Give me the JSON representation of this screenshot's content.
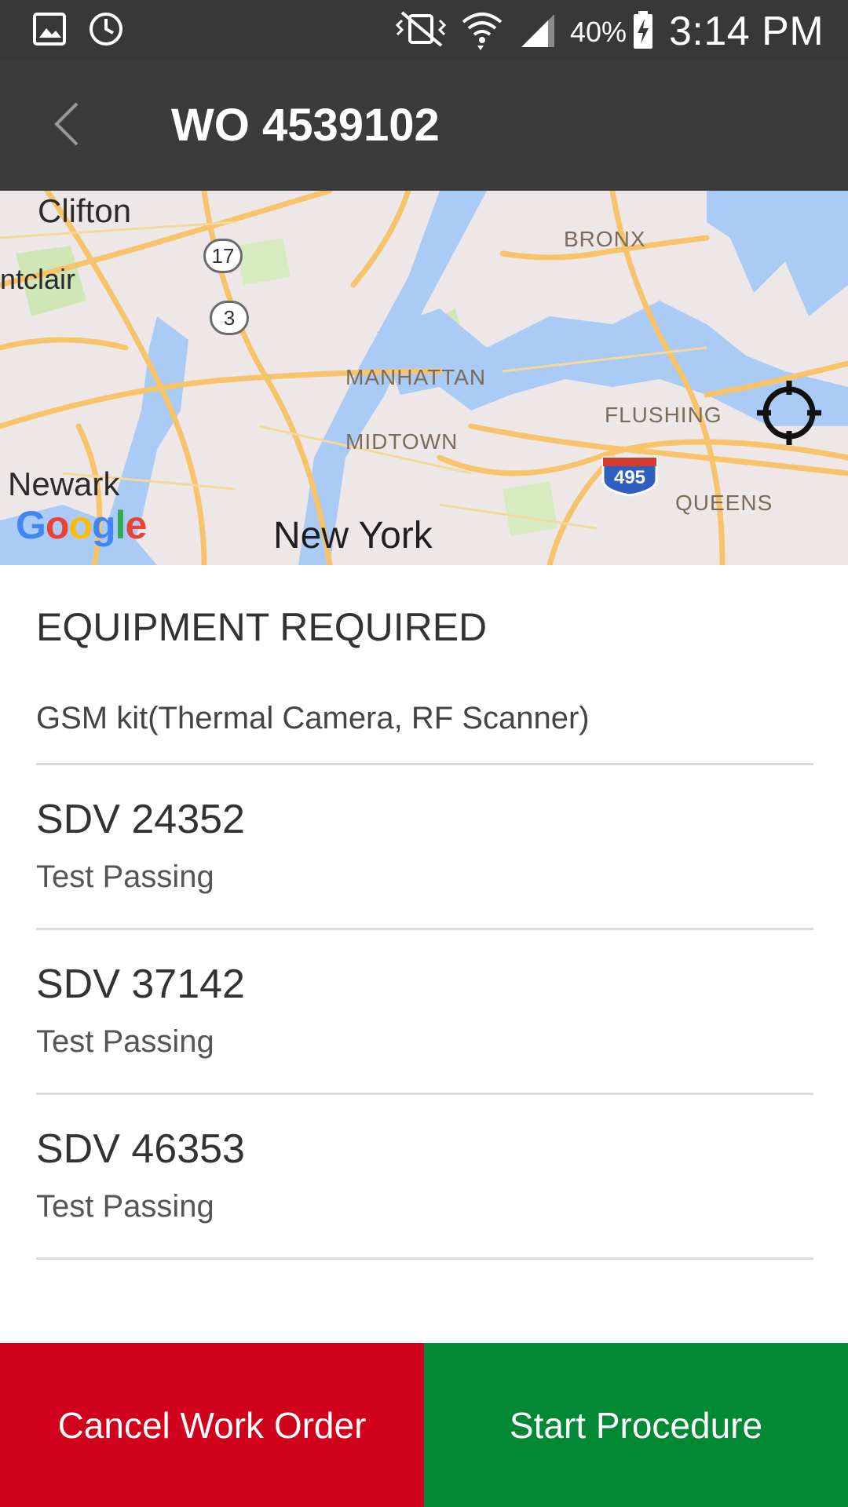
{
  "status_bar": {
    "battery_percent": "40%",
    "time": "3:14 PM",
    "icons": [
      "gallery-icon",
      "sync-icon",
      "vibrate-icon",
      "wifi-icon",
      "signal-icon",
      "battery-charging-icon"
    ]
  },
  "app_bar": {
    "title": "WO 4539102",
    "back_icon": "chevron-left-icon"
  },
  "map": {
    "labels": {
      "clifton": "Clifton",
      "montclair": "ntclair",
      "bronx": "BRONX",
      "manhattan": "MANHATTAN",
      "midtown": "MIDTOWN",
      "flushing": "FLUSHING",
      "queens": "QUEENS",
      "newark": "Newark",
      "new_york": "New York"
    },
    "route_shields": {
      "r17": "17",
      "r3": "3",
      "i495": "495"
    },
    "logo": {
      "g1": "G",
      "o1": "o",
      "o2": "o",
      "g2": "g",
      "l": "l",
      "e": "e"
    },
    "locate_icon": "crosshair-icon"
  },
  "equipment": {
    "heading": "EQUIPMENT REQUIRED",
    "description": "GSM kit(Thermal Camera, RF Scanner)"
  },
  "devices": [
    {
      "name": "SDV 24352",
      "status": "Test Passing"
    },
    {
      "name": "SDV 37142",
      "status": "Test Passing"
    },
    {
      "name": "SDV 46353",
      "status": "Test Passing"
    }
  ],
  "actions": {
    "cancel_label": "Cancel Work Order",
    "start_label": "Start Procedure"
  },
  "colors": {
    "status_bar": "#383838",
    "app_bar": "#3b3b3b",
    "cancel": "#d0021b",
    "start": "#038835",
    "water": "#a9cbf5",
    "road": "#f7c46c",
    "park": "#cde8b0"
  }
}
